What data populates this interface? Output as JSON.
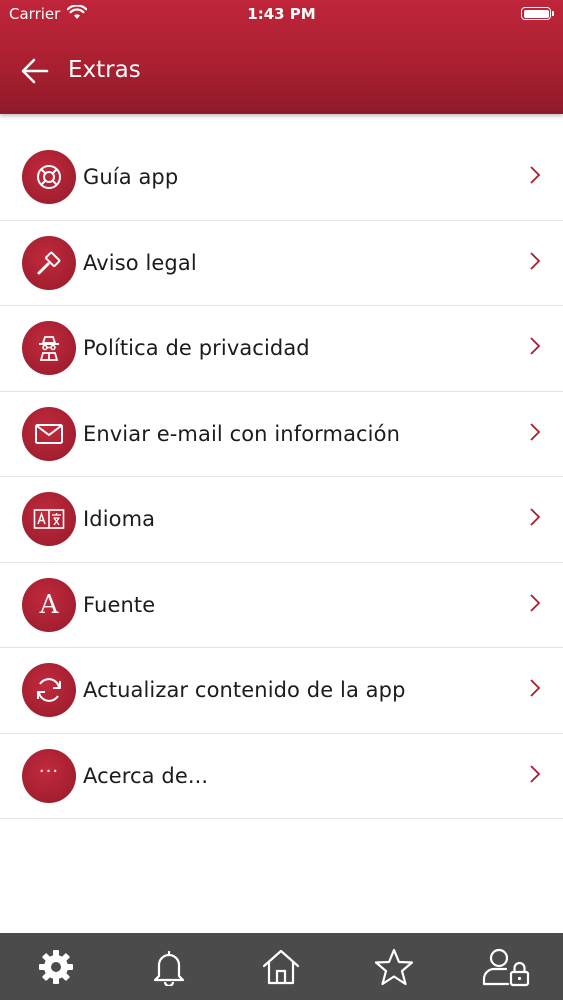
{
  "status": {
    "carrier": "Carrier",
    "time": "1:43 PM"
  },
  "header": {
    "title": "Extras"
  },
  "colors": {
    "primary": "#a81f30",
    "tabbar": "#4b4b4b",
    "chevron": "#a81f30"
  },
  "menu": [
    {
      "label": "Guía app",
      "icon": "lifebuoy-icon"
    },
    {
      "label": "Aviso legal",
      "icon": "gavel-icon"
    },
    {
      "label": "Política de privacidad",
      "icon": "spy-icon"
    },
    {
      "label": "Enviar e-mail con información",
      "icon": "envelope-icon"
    },
    {
      "label": "Idioma",
      "icon": "language-icon",
      "glyph": "A|文"
    },
    {
      "label": "Fuente",
      "icon": "font-icon",
      "glyph": "A"
    },
    {
      "label": "Actualizar contenido de la app",
      "icon": "refresh-icon"
    },
    {
      "label": "Acerca de...",
      "icon": "more-icon",
      "glyph": "···"
    }
  ],
  "tabs": [
    {
      "name": "settings",
      "icon": "gear-icon"
    },
    {
      "name": "notifications",
      "icon": "bell-icon"
    },
    {
      "name": "home",
      "icon": "home-icon"
    },
    {
      "name": "favorites",
      "icon": "star-icon"
    },
    {
      "name": "account",
      "icon": "user-lock-icon"
    }
  ]
}
